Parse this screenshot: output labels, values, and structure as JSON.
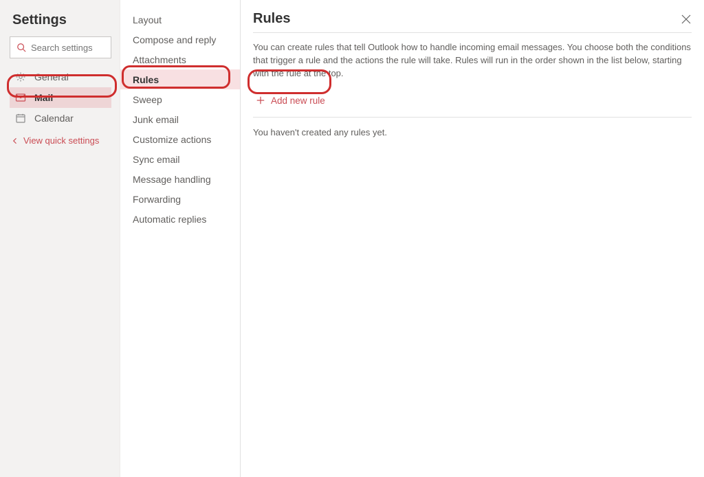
{
  "title": "Settings",
  "search": {
    "placeholder": "Search settings"
  },
  "left_nav": {
    "items": [
      {
        "id": "general",
        "label": "General"
      },
      {
        "id": "mail",
        "label": "Mail"
      },
      {
        "id": "calendar",
        "label": "Calendar"
      }
    ],
    "quick_link": "View quick settings"
  },
  "mid_nav": {
    "items": [
      {
        "id": "layout",
        "label": "Layout"
      },
      {
        "id": "compose",
        "label": "Compose and reply"
      },
      {
        "id": "attach",
        "label": "Attachments"
      },
      {
        "id": "rules",
        "label": "Rules"
      },
      {
        "id": "sweep",
        "label": "Sweep"
      },
      {
        "id": "junk",
        "label": "Junk email"
      },
      {
        "id": "custom",
        "label": "Customize actions"
      },
      {
        "id": "sync",
        "label": "Sync email"
      },
      {
        "id": "msgh",
        "label": "Message handling"
      },
      {
        "id": "fwd",
        "label": "Forwarding"
      },
      {
        "id": "auto",
        "label": "Automatic replies"
      }
    ],
    "active": "rules"
  },
  "main": {
    "title": "Rules",
    "description": "You can create rules that tell Outlook how to handle incoming email messages. You choose both the conditions that trigger a rule and the actions the rule will take. Rules will run in the order shown in the list below, starting with the rule at the top.",
    "add_label": "Add new rule",
    "empty": "You haven't created any rules yet."
  },
  "colors": {
    "accent": "#ca4c54",
    "highlight_border": "#cf2e2e"
  }
}
